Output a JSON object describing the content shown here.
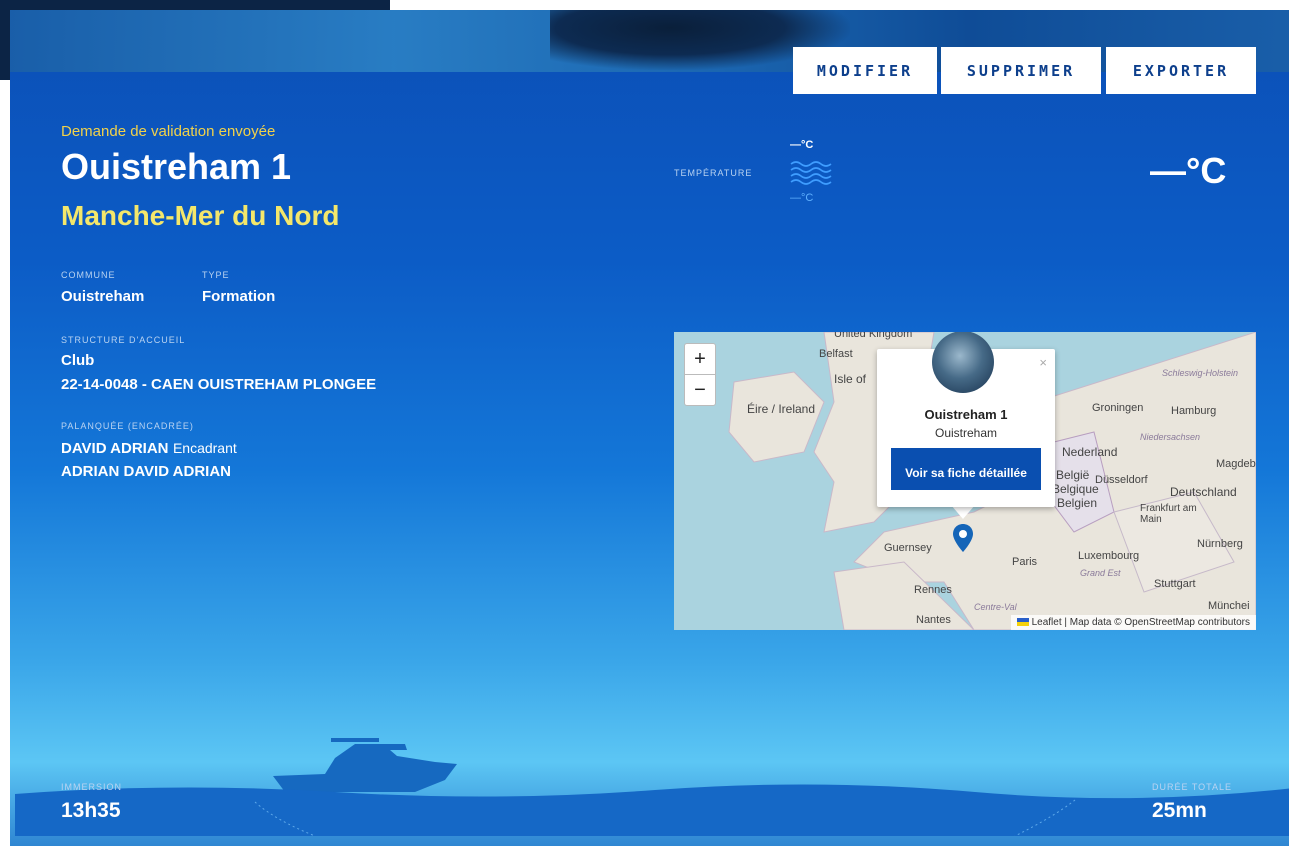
{
  "toolbar": {
    "modifier": "MODIFIER",
    "supprimer": "SUPPRIMER",
    "exporter": "EXPORTER"
  },
  "dive": {
    "status": "Demande de validation envoyée",
    "title": "Ouistreham 1",
    "region": "Manche-Mer du Nord"
  },
  "details": {
    "commune_label": "COMMUNE",
    "commune_value": "Ouistreham",
    "type_label": "TYPE",
    "type_value": "Formation",
    "structure_label": "STRUCTURE D'ACCUEIL",
    "structure_type": "Club",
    "structure_name": "22-14-0048 - CAEN OUISTREHAM PLONGEE",
    "palanquee_label": "PALANQUÉE (ENCADRÉE)",
    "members": [
      {
        "name": "DAVID ADRIAN",
        "role": "Encadrant"
      },
      {
        "name": "ADRIAN DAVID ADRIAN",
        "role": ""
      }
    ]
  },
  "temperature": {
    "label": "TEMPÉRATURE",
    "surface": "—°C",
    "bottom": "—°C",
    "main": "—°C"
  },
  "map": {
    "zoom_in": "+",
    "zoom_out": "−",
    "popup": {
      "title": "Ouistreham 1",
      "subtitle": "Ouistreham",
      "button": "Voir sa fiche détaillée",
      "close": "×"
    },
    "attribution": "Leaflet | Map data © OpenStreetMap contributors",
    "labels": {
      "uk": "United Kingdom",
      "belfast": "Belfast",
      "isle": "Isle of",
      "ireland": "Éire / Ireland",
      "groningen": "Groningen",
      "hamburg": "Hamburg",
      "niedersachsen": "Niedersachsen",
      "nederland": "Nederland",
      "magdeburg": "Magdebur",
      "dusseldorf": "Düsseldorf",
      "deutschland": "Deutschland",
      "belgie": "België",
      "belgique": "Belgique",
      "belgien": "Belgien",
      "frankfurt": "Frankfurt am Main",
      "guernsey": "Guernsey",
      "paris": "Paris",
      "luxembourg": "Luxembourg",
      "nurnberg": "Nürnberg",
      "grandest": "Grand Est",
      "stuttgart": "Stuttgart",
      "rennes": "Rennes",
      "nantes": "Nantes",
      "munchen": "Münchei",
      "schleswig": "Schleswig-Holstein",
      "centre": "Centre-Val"
    }
  },
  "footer": {
    "immersion_label": "IMMERSION",
    "immersion_value": "13h35",
    "duree_label": "DURÉE TOTALE",
    "duree_value": "25mn"
  },
  "colors": {
    "accent_yellow": "#f4e76b",
    "brand_blue": "#0a4fb0"
  }
}
